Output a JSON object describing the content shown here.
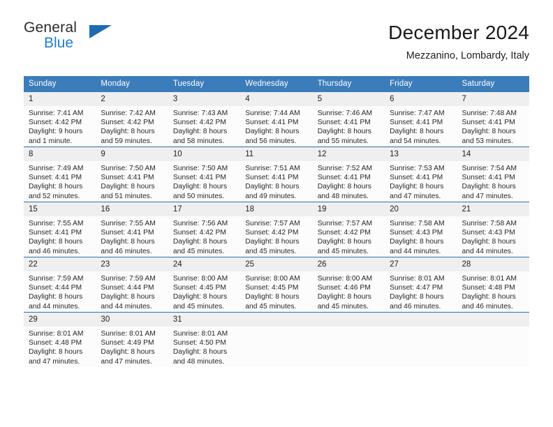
{
  "brand": {
    "name_top": "General",
    "name_bottom": "Blue",
    "accent_color": "#1c7fd4",
    "triangle_color": "#1c6cb0"
  },
  "header": {
    "title": "December 2024",
    "subtitle": "Mezzanino, Lombardy, Italy"
  },
  "theme": {
    "header_blue": "#3b7cba",
    "row_divider": "#2e72ad",
    "daynum_band": "#efefef",
    "cell_bg": "#fcfcfc"
  },
  "weekday_headers": [
    "Sunday",
    "Monday",
    "Tuesday",
    "Wednesday",
    "Thursday",
    "Friday",
    "Saturday"
  ],
  "labels": {
    "sunrise_prefix": "Sunrise:",
    "sunset_prefix": "Sunset:",
    "daylight_prefix": "Daylight:"
  },
  "weeks": [
    [
      {
        "day": "1",
        "sunrise": "Sunrise: 7:41 AM",
        "sunset": "Sunset: 4:42 PM",
        "daylight1": "Daylight: 9 hours",
        "daylight2": "and 1 minute."
      },
      {
        "day": "2",
        "sunrise": "Sunrise: 7:42 AM",
        "sunset": "Sunset: 4:42 PM",
        "daylight1": "Daylight: 8 hours",
        "daylight2": "and 59 minutes."
      },
      {
        "day": "3",
        "sunrise": "Sunrise: 7:43 AM",
        "sunset": "Sunset: 4:42 PM",
        "daylight1": "Daylight: 8 hours",
        "daylight2": "and 58 minutes."
      },
      {
        "day": "4",
        "sunrise": "Sunrise: 7:44 AM",
        "sunset": "Sunset: 4:41 PM",
        "daylight1": "Daylight: 8 hours",
        "daylight2": "and 56 minutes."
      },
      {
        "day": "5",
        "sunrise": "Sunrise: 7:46 AM",
        "sunset": "Sunset: 4:41 PM",
        "daylight1": "Daylight: 8 hours",
        "daylight2": "and 55 minutes."
      },
      {
        "day": "6",
        "sunrise": "Sunrise: 7:47 AM",
        "sunset": "Sunset: 4:41 PM",
        "daylight1": "Daylight: 8 hours",
        "daylight2": "and 54 minutes."
      },
      {
        "day": "7",
        "sunrise": "Sunrise: 7:48 AM",
        "sunset": "Sunset: 4:41 PM",
        "daylight1": "Daylight: 8 hours",
        "daylight2": "and 53 minutes."
      }
    ],
    [
      {
        "day": "8",
        "sunrise": "Sunrise: 7:49 AM",
        "sunset": "Sunset: 4:41 PM",
        "daylight1": "Daylight: 8 hours",
        "daylight2": "and 52 minutes."
      },
      {
        "day": "9",
        "sunrise": "Sunrise: 7:50 AM",
        "sunset": "Sunset: 4:41 PM",
        "daylight1": "Daylight: 8 hours",
        "daylight2": "and 51 minutes."
      },
      {
        "day": "10",
        "sunrise": "Sunrise: 7:50 AM",
        "sunset": "Sunset: 4:41 PM",
        "daylight1": "Daylight: 8 hours",
        "daylight2": "and 50 minutes."
      },
      {
        "day": "11",
        "sunrise": "Sunrise: 7:51 AM",
        "sunset": "Sunset: 4:41 PM",
        "daylight1": "Daylight: 8 hours",
        "daylight2": "and 49 minutes."
      },
      {
        "day": "12",
        "sunrise": "Sunrise: 7:52 AM",
        "sunset": "Sunset: 4:41 PM",
        "daylight1": "Daylight: 8 hours",
        "daylight2": "and 48 minutes."
      },
      {
        "day": "13",
        "sunrise": "Sunrise: 7:53 AM",
        "sunset": "Sunset: 4:41 PM",
        "daylight1": "Daylight: 8 hours",
        "daylight2": "and 47 minutes."
      },
      {
        "day": "14",
        "sunrise": "Sunrise: 7:54 AM",
        "sunset": "Sunset: 4:41 PM",
        "daylight1": "Daylight: 8 hours",
        "daylight2": "and 47 minutes."
      }
    ],
    [
      {
        "day": "15",
        "sunrise": "Sunrise: 7:55 AM",
        "sunset": "Sunset: 4:41 PM",
        "daylight1": "Daylight: 8 hours",
        "daylight2": "and 46 minutes."
      },
      {
        "day": "16",
        "sunrise": "Sunrise: 7:55 AM",
        "sunset": "Sunset: 4:41 PM",
        "daylight1": "Daylight: 8 hours",
        "daylight2": "and 46 minutes."
      },
      {
        "day": "17",
        "sunrise": "Sunrise: 7:56 AM",
        "sunset": "Sunset: 4:42 PM",
        "daylight1": "Daylight: 8 hours",
        "daylight2": "and 45 minutes."
      },
      {
        "day": "18",
        "sunrise": "Sunrise: 7:57 AM",
        "sunset": "Sunset: 4:42 PM",
        "daylight1": "Daylight: 8 hours",
        "daylight2": "and 45 minutes."
      },
      {
        "day": "19",
        "sunrise": "Sunrise: 7:57 AM",
        "sunset": "Sunset: 4:42 PM",
        "daylight1": "Daylight: 8 hours",
        "daylight2": "and 45 minutes."
      },
      {
        "day": "20",
        "sunrise": "Sunrise: 7:58 AM",
        "sunset": "Sunset: 4:43 PM",
        "daylight1": "Daylight: 8 hours",
        "daylight2": "and 44 minutes."
      },
      {
        "day": "21",
        "sunrise": "Sunrise: 7:58 AM",
        "sunset": "Sunset: 4:43 PM",
        "daylight1": "Daylight: 8 hours",
        "daylight2": "and 44 minutes."
      }
    ],
    [
      {
        "day": "22",
        "sunrise": "Sunrise: 7:59 AM",
        "sunset": "Sunset: 4:44 PM",
        "daylight1": "Daylight: 8 hours",
        "daylight2": "and 44 minutes."
      },
      {
        "day": "23",
        "sunrise": "Sunrise: 7:59 AM",
        "sunset": "Sunset: 4:44 PM",
        "daylight1": "Daylight: 8 hours",
        "daylight2": "and 44 minutes."
      },
      {
        "day": "24",
        "sunrise": "Sunrise: 8:00 AM",
        "sunset": "Sunset: 4:45 PM",
        "daylight1": "Daylight: 8 hours",
        "daylight2": "and 45 minutes."
      },
      {
        "day": "25",
        "sunrise": "Sunrise: 8:00 AM",
        "sunset": "Sunset: 4:45 PM",
        "daylight1": "Daylight: 8 hours",
        "daylight2": "and 45 minutes."
      },
      {
        "day": "26",
        "sunrise": "Sunrise: 8:00 AM",
        "sunset": "Sunset: 4:46 PM",
        "daylight1": "Daylight: 8 hours",
        "daylight2": "and 45 minutes."
      },
      {
        "day": "27",
        "sunrise": "Sunrise: 8:01 AM",
        "sunset": "Sunset: 4:47 PM",
        "daylight1": "Daylight: 8 hours",
        "daylight2": "and 46 minutes."
      },
      {
        "day": "28",
        "sunrise": "Sunrise: 8:01 AM",
        "sunset": "Sunset: 4:48 PM",
        "daylight1": "Daylight: 8 hours",
        "daylight2": "and 46 minutes."
      }
    ],
    [
      {
        "day": "29",
        "sunrise": "Sunrise: 8:01 AM",
        "sunset": "Sunset: 4:48 PM",
        "daylight1": "Daylight: 8 hours",
        "daylight2": "and 47 minutes."
      },
      {
        "day": "30",
        "sunrise": "Sunrise: 8:01 AM",
        "sunset": "Sunset: 4:49 PM",
        "daylight1": "Daylight: 8 hours",
        "daylight2": "and 47 minutes."
      },
      {
        "day": "31",
        "sunrise": "Sunrise: 8:01 AM",
        "sunset": "Sunset: 4:50 PM",
        "daylight1": "Daylight: 8 hours",
        "daylight2": "and 48 minutes."
      },
      {
        "day": "",
        "sunrise": "",
        "sunset": "",
        "daylight1": "",
        "daylight2": ""
      },
      {
        "day": "",
        "sunrise": "",
        "sunset": "",
        "daylight1": "",
        "daylight2": ""
      },
      {
        "day": "",
        "sunrise": "",
        "sunset": "",
        "daylight1": "",
        "daylight2": ""
      },
      {
        "day": "",
        "sunrise": "",
        "sunset": "",
        "daylight1": "",
        "daylight2": ""
      }
    ]
  ]
}
